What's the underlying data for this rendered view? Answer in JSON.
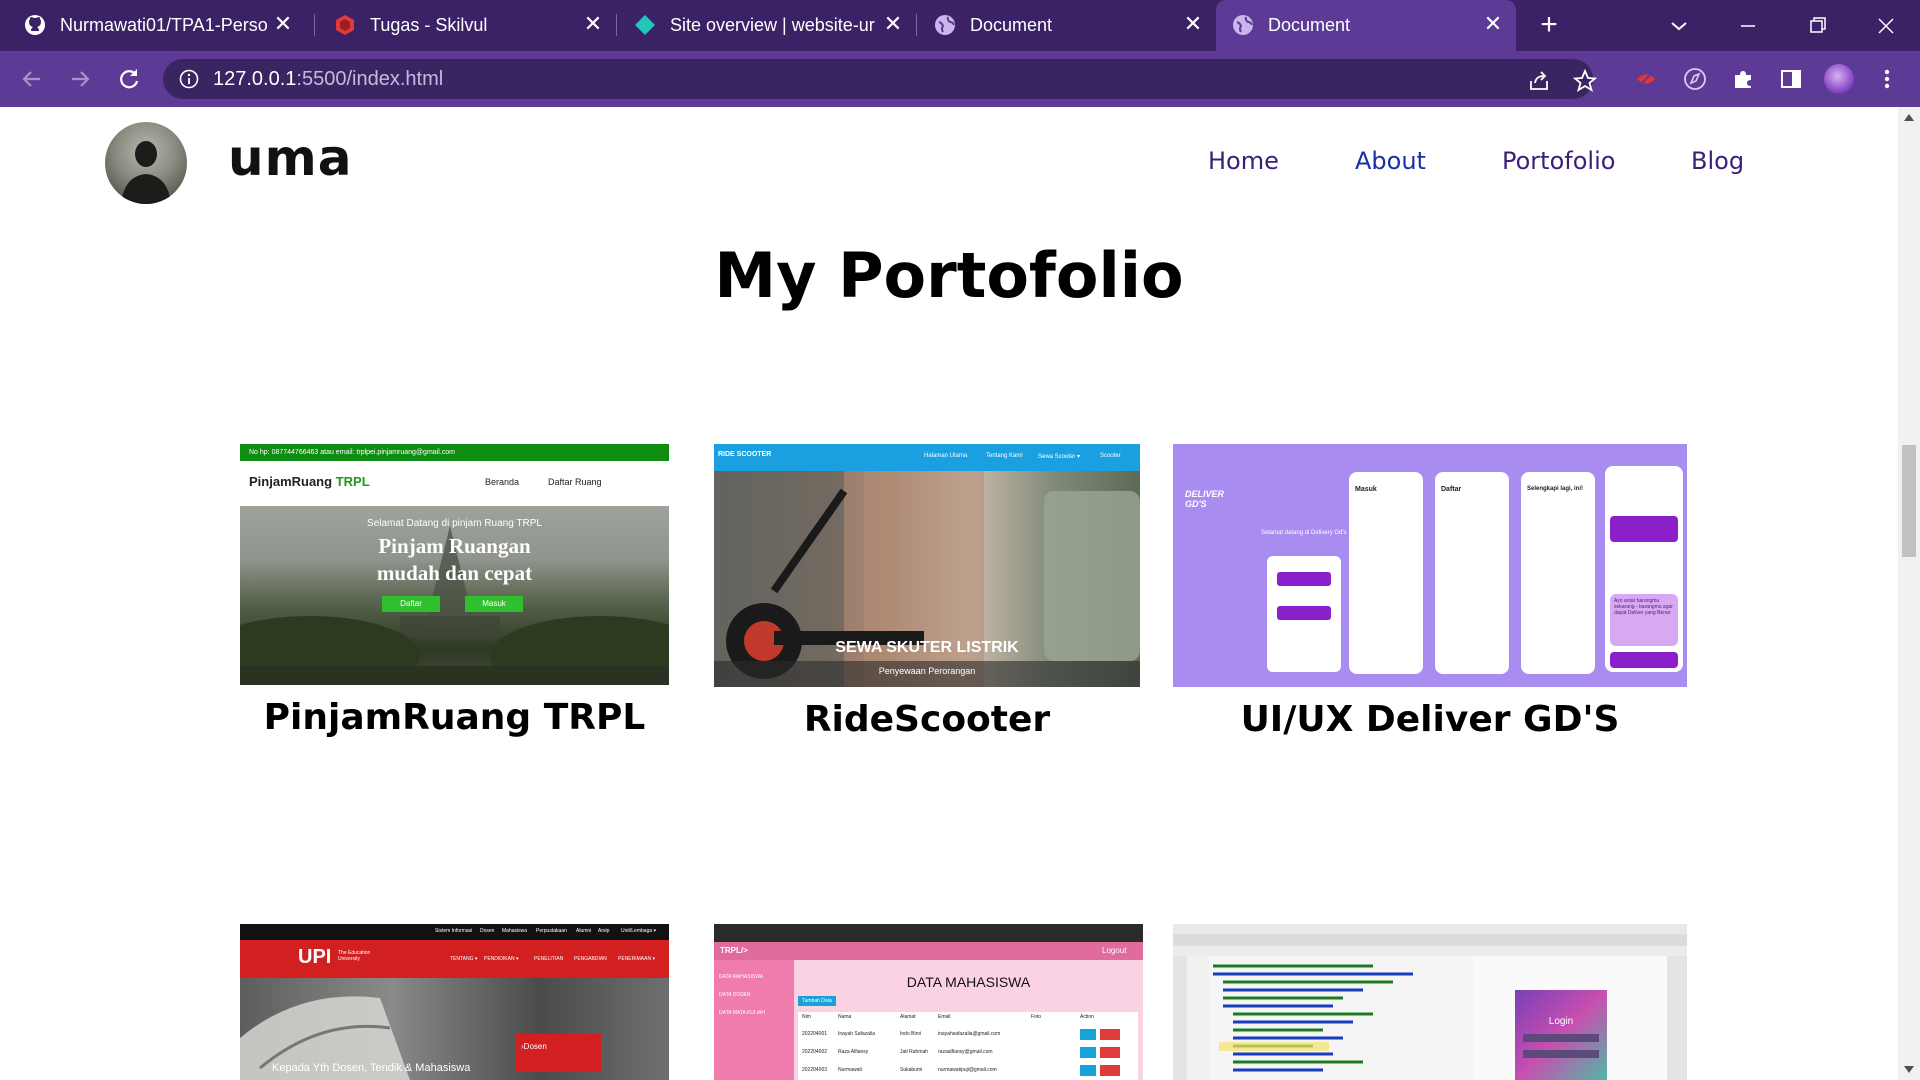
{
  "browser": {
    "tabs": [
      {
        "title": "Nurmawati01/TPA1-Perso",
        "icon": "github-icon"
      },
      {
        "title": "Tugas - Skilvul",
        "icon": "skilvul-icon"
      },
      {
        "title": "Site overview | website-ur",
        "icon": "netlify-icon"
      },
      {
        "title": "Document",
        "icon": "globe-icon"
      },
      {
        "title": "Document",
        "icon": "globe-icon",
        "active": true
      }
    ],
    "url_host": "127.0.0.1",
    "url_rest": ":5500/index.html",
    "theme_color": "#5c3a95"
  },
  "site": {
    "brand": "uma",
    "nav": [
      "Home",
      "About",
      "Portofolio",
      "Blog"
    ],
    "active_nav": "About",
    "page_title": "My Portofolio",
    "projects": [
      {
        "title": "PinjamRuang TRPL",
        "preview": {
          "topbar": "No hp: 087744766463 atau email: trplpei.pinjamruang@gmail.com",
          "logo_a": "PinjamRuang",
          "logo_b": "TRPL",
          "menu": [
            "Beranda",
            "Daftar Ruang"
          ],
          "welcome": "Selamat Datang di pinjam Ruang TRPL",
          "headline_1": "Pinjam Ruangan",
          "headline_2": "mudah dan cepat",
          "buttons": [
            "Daftar",
            "Masuk"
          ]
        }
      },
      {
        "title": "RideScooter",
        "preview": {
          "logo": "RIDE SCOOTER",
          "menu": [
            "Halaman Utama",
            "Tentang Kami",
            "Sewa Scooter ▾",
            "Scooter"
          ],
          "headline": "SEWA SKUTER LISTRIK",
          "sub": "Penyewaan Perorangan"
        }
      },
      {
        "title": "UI/UX Deliver GD'S",
        "preview": {
          "brand": "DELIVER GD'S",
          "welcome": "Selamat datang di Delivery Gd's",
          "screens": [
            "Masuk",
            "Daftar",
            "Selengkapi lagi, ini!"
          ],
          "cta": "Ayo antar barangmu sekarang - barangmu agar dapat Deliver yang Benar"
        }
      },
      {
        "title": "",
        "preview": {
          "menu": [
            "Sistem Informasi",
            "Dosen",
            "Mahasiswa",
            "Perpustakaan",
            "Alumni",
            "Arsip",
            "Unit/Lembaga ▾"
          ],
          "logo": "UPI",
          "logo_sub": "The Education University",
          "submenu": [
            "TENTANG ▾",
            "PENDIDIKAN ▾",
            "PENELITIAN",
            "PENGABDIAN",
            "PENERIMAAN ▾"
          ],
          "caption": "Kepada Yth Dosen, Tendik & Mahasiswa",
          "badge": "Dosen"
        }
      },
      {
        "title": "",
        "preview": {
          "brand": "TRPL/>",
          "logout": "Logout",
          "sidebar": [
            "DATA MAHASISWA",
            "DATA DOSEN",
            "DATA MATA KULIAH"
          ],
          "heading": "DATA MAHASISWA",
          "add": "Tambah Data",
          "columns": [
            "Nim",
            "Nama",
            "Alamat",
            "Email",
            "Foto",
            "Action"
          ],
          "rows": [
            [
              "202204001",
              "Inayah Safazalia",
              "Indo Biroi",
              "inayahsafazalia@gmail.com"
            ],
            [
              "202204002",
              "Raza Alfiansy",
              "Jati Rahmah",
              "razaalfiansy@gmail.com"
            ],
            [
              "202204003",
              "Nurmawati",
              "Sukabumi",
              "nurmawatipuji@gmail.com"
            ]
          ]
        }
      },
      {
        "title": "",
        "preview": {
          "login": "Login"
        }
      }
    ]
  }
}
